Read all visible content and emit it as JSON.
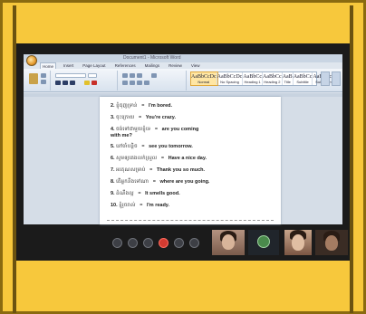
{
  "window": {
    "title": "Document1 - Microsoft Word"
  },
  "ribbon": {
    "tabs": [
      "Home",
      "Insert",
      "Page Layout",
      "References",
      "Mailings",
      "Review",
      "View"
    ],
    "styles": [
      "AaBbCcDc",
      "AaBbCcDc",
      "AaBbCc",
      "AaBbCc",
      "AaB",
      "AaBbCc",
      "AaBbCcDc"
    ],
    "style_names": [
      "Normal",
      "No Spacing",
      "Heading 1",
      "Heading 2",
      "Title",
      "Subtitle",
      "Subtle Em..."
    ]
  },
  "document": {
    "lines": [
      {
        "num": "2.",
        "khmer": "ខ្ញុំធុញទ្រាន់",
        "english": "I'm bored."
      },
      {
        "num": "3.",
        "khmer": "ចុះក្រោយ",
        "english": "You're crazy."
      },
      {
        "num": "4.",
        "khmer": "ចង់ទៅជាមួយខ្ញុំទេ",
        "english": "are you coming"
      },
      {
        "num": "5.",
        "khmer": "នៅចាំបន្តិច",
        "english": "see you tomorrow."
      },
      {
        "num": "6.",
        "khmer": "សូមឲ្យគេងលក់ស្រួល",
        "english": "Have a nice day."
      },
      {
        "num": "7.",
        "khmer": "អរគុណសម្រាប់",
        "english": "Thank you so much."
      },
      {
        "num": "8.",
        "khmer": "តើអ្នកនឹងទៅណា",
        "english": "where are you going."
      },
      {
        "num": "9.",
        "khmer": "ដំណឹងល្អ",
        "english": "It smells good."
      },
      {
        "num": "10.",
        "khmer": "ខ្ញុំរួចរាល់",
        "english": "I'm ready."
      }
    ],
    "continuation": "with me?"
  },
  "meeting": {
    "controls": [
      "mic-icon",
      "video-icon",
      "share-icon",
      "end-call-icon",
      "chat-icon",
      "more-icon"
    ],
    "colors": {
      "end_call": "#d23b31",
      "frame": "#f7c83c"
    }
  }
}
